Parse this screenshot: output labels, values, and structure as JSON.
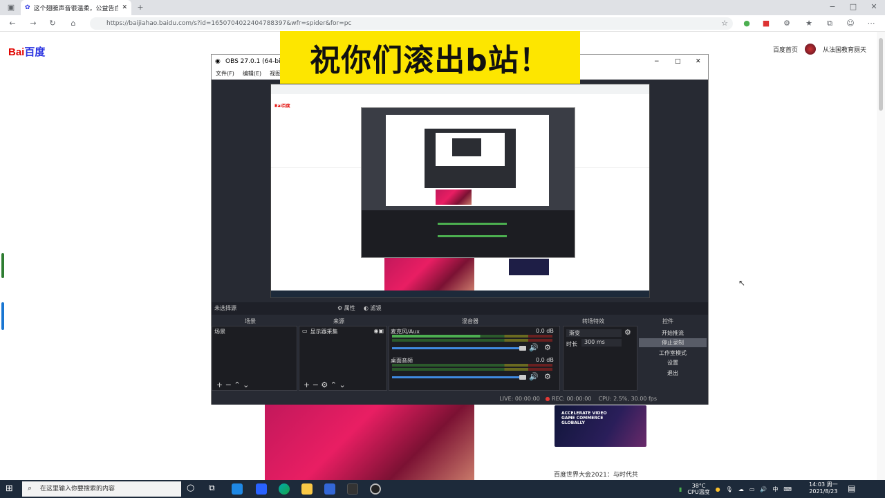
{
  "browser": {
    "tab_title": "这个翅膀声音很温柔，公益告白",
    "url": "https://baijiahao.baidu.com/s?id=1650704022404788397&wfr=spider&for=pc"
  },
  "page": {
    "logo_bai": "Bai",
    "logo_du": "百度",
    "header_link_home": "百度首页",
    "header_link_user": "从法国教育厕天",
    "banner_text": "祝你们滚出b站！",
    "caption": "百度世界大会2021：与时代共",
    "ad_text": "ACCELERATE VIDEO GAME COMMERCE GLOBALLY"
  },
  "obs": {
    "title": "OBS 27.0.1 (64-bit, w",
    "menu": [
      "文件(F)",
      "编辑(E)",
      "视图(V)"
    ],
    "no_source": "未选择源",
    "properties": "属性",
    "filters": "滤镜",
    "docks": {
      "scenes": "场景",
      "sources": "来源",
      "mixer": "混音器",
      "transitions": "转场特效",
      "controls": "控件"
    },
    "scene_item": "场景",
    "source_item": "显示器采集",
    "mixer": [
      {
        "name": "麦克风/Aux",
        "db": "0.0 dB"
      },
      {
        "name": "桌面音频",
        "db": "0.0 dB"
      }
    ],
    "transition": {
      "type": "渐变",
      "duration_label": "时长",
      "duration": "300 ms"
    },
    "controls": [
      "开始推流",
      "停止录制",
      "工作室模式",
      "设置",
      "退出"
    ],
    "status": {
      "live": "LIVE: 00:00:00",
      "rec": "REC: 00:00:00",
      "cpu": "CPU: 2.5%, 30.00 fps"
    }
  },
  "taskbar": {
    "search_placeholder": "在这里输入你要搜索的内容",
    "temp": "38°C",
    "cpu_label": "CPU温度",
    "time": "14:03 周一",
    "date": "2021/8/23"
  },
  "colors": {
    "banner": "#fde600",
    "obs_bg": "#272a33",
    "taskbar": "#1d2a3a",
    "baidu_red": "#e10602",
    "baidu_blue": "#2932e1"
  }
}
